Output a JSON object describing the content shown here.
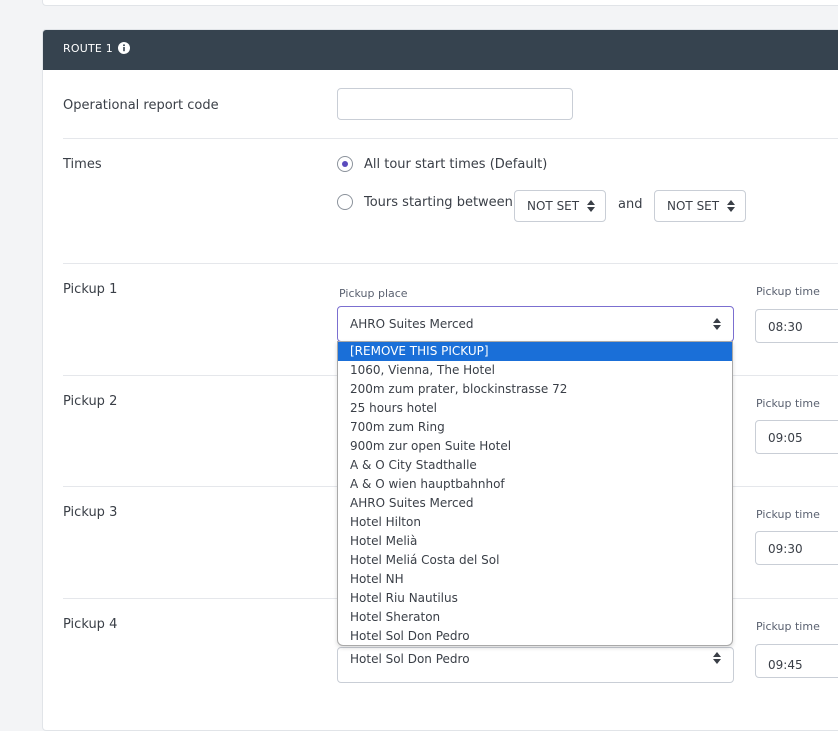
{
  "route": {
    "title": "ROUTE 1",
    "report_code_label": "Operational report code",
    "report_code_value": "",
    "times_label": "Times",
    "option_all": "All tour start times (Default)",
    "option_between": "Tours starting between",
    "between_from": "NOT SET",
    "between_and": "and",
    "between_to": "NOT SET"
  },
  "pickups": [
    {
      "label": "Pickup 1",
      "place_label": "Pickup place",
      "place": "AHRO Suites Merced",
      "time_label": "Pickup time",
      "time": "08:30"
    },
    {
      "label": "Pickup 2",
      "time_label": "Pickup time",
      "time": "09:05"
    },
    {
      "label": "Pickup 3",
      "time_label": "Pickup time",
      "time": "09:30"
    },
    {
      "label": "Pickup 4",
      "place": "Hotel Sol Don Pedro",
      "time_label": "Pickup time",
      "time": "09:45"
    }
  ],
  "dropdown_options": [
    "[REMOVE THIS PICKUP]",
    "1060, Vienna, The Hotel",
    "200m zum prater, blockinstrasse 72",
    "25 hours hotel",
    "700m zum Ring",
    "900m zur open Suite Hotel",
    "A & O City Stadthalle",
    "A & O wien hauptbahnhof",
    "AHRO Suites Merced",
    "Hotel Hilton",
    "Hotel Melià",
    "Hotel Meliá Costa del Sol",
    "Hotel NH",
    "Hotel Riu Nautilus",
    "Hotel Sheraton",
    "Hotel Sol Don Pedro"
  ],
  "colors": {
    "header": "#36434f",
    "accent": "#5b4bbd",
    "highlight": "#1a6fd8"
  },
  "icons": {
    "info": "info-icon",
    "select_arrows": "updown-icon"
  }
}
